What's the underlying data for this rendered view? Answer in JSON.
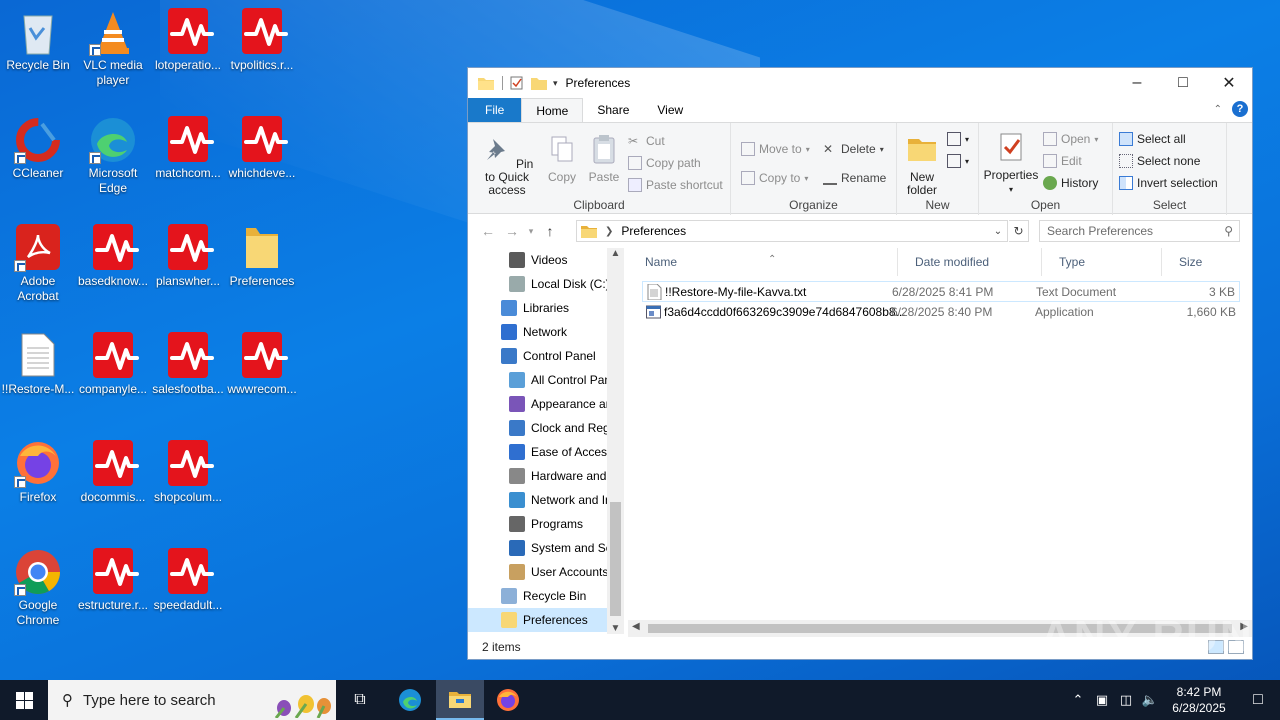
{
  "desktop": {
    "icons": [
      {
        "label": "Recycle Bin",
        "icon": "recycle-bin-icon"
      },
      {
        "label": "VLC media player",
        "icon": "vlc-icon"
      },
      {
        "label": "lotoperatio...",
        "icon": "red-pulse-icon"
      },
      {
        "label": "tvpolitics.r...",
        "icon": "red-pulse-icon"
      },
      {
        "label": "CCleaner",
        "icon": "ccleaner-icon"
      },
      {
        "label": "Microsoft Edge",
        "icon": "edge-icon"
      },
      {
        "label": "matchcom...",
        "icon": "red-pulse-icon"
      },
      {
        "label": "whichdeve...",
        "icon": "red-pulse-icon"
      },
      {
        "label": "Adobe Acrobat",
        "icon": "acrobat-icon"
      },
      {
        "label": "basedknow...",
        "icon": "red-pulse-icon"
      },
      {
        "label": "planswher...",
        "icon": "red-pulse-icon"
      },
      {
        "label": "Preferences",
        "icon": "folder-icon"
      },
      {
        "label": "!!Restore-M...",
        "icon": "text-file-icon"
      },
      {
        "label": "companyle...",
        "icon": "red-pulse-icon"
      },
      {
        "label": "salesfootba...",
        "icon": "red-pulse-icon"
      },
      {
        "label": "wwwrecom...",
        "icon": "red-pulse-icon"
      },
      {
        "label": "Firefox",
        "icon": "firefox-icon"
      },
      {
        "label": "docommis...",
        "icon": "red-pulse-icon"
      },
      {
        "label": "shopcolum...",
        "icon": "red-pulse-icon"
      },
      {
        "label": "Google Chrome",
        "icon": "chrome-icon"
      },
      {
        "label": "estructure.r...",
        "icon": "red-pulse-icon"
      },
      {
        "label": "speedadult...",
        "icon": "red-pulse-icon"
      }
    ]
  },
  "explorer": {
    "title": "Preferences",
    "tabs": {
      "file": "File",
      "home": "Home",
      "share": "Share",
      "view": "View"
    },
    "ribbon": {
      "clipboard": {
        "name": "Clipboard",
        "pin": "Pin to Quick access",
        "copy": "Copy",
        "paste": "Paste",
        "cut": "Cut",
        "copy_path": "Copy path",
        "paste_shortcut": "Paste shortcut"
      },
      "organize": {
        "name": "Organize",
        "move_to": "Move to",
        "copy_to": "Copy to",
        "delete": "Delete",
        "rename": "Rename"
      },
      "new": {
        "name": "New",
        "new_folder": "New folder"
      },
      "open": {
        "name": "Open",
        "properties": "Properties",
        "open": "Open",
        "edit": "Edit",
        "history": "History"
      },
      "select": {
        "name": "Select",
        "select_all": "Select all",
        "select_none": "Select none",
        "invert": "Invert selection"
      }
    },
    "address": "Preferences",
    "search_placeholder": "Search Preferences",
    "nav": [
      {
        "label": "Videos",
        "indent": 2
      },
      {
        "label": "Local Disk (C:)",
        "indent": 2
      },
      {
        "label": "Libraries",
        "indent": 1
      },
      {
        "label": "Network",
        "indent": 1
      },
      {
        "label": "Control Panel",
        "indent": 1
      },
      {
        "label": "All Control Panel Items",
        "indent": 2
      },
      {
        "label": "Appearance and Personalization",
        "indent": 2
      },
      {
        "label": "Clock and Region",
        "indent": 2
      },
      {
        "label": "Ease of Access",
        "indent": 2
      },
      {
        "label": "Hardware and Sound",
        "indent": 2
      },
      {
        "label": "Network and Internet",
        "indent": 2
      },
      {
        "label": "Programs",
        "indent": 2
      },
      {
        "label": "System and Security",
        "indent": 2
      },
      {
        "label": "User Accounts",
        "indent": 2
      },
      {
        "label": "Recycle Bin",
        "indent": 1
      },
      {
        "label": "Preferences",
        "indent": 1
      }
    ],
    "columns": {
      "name": "Name",
      "date": "Date modified",
      "type": "Type",
      "size": "Size"
    },
    "files": [
      {
        "name": "!!Restore-My-file-Kavva.txt",
        "date": "6/28/2025 8:41 PM",
        "type": "Text Document",
        "size": "3 KB"
      },
      {
        "name": "f3a6d4ccdd0f663269c3909e74d6847608b8...",
        "date": "6/28/2025 8:40 PM",
        "type": "Application",
        "size": "1,660 KB"
      }
    ],
    "status": "2 items"
  },
  "watermark": "ANY RUN",
  "taskbar": {
    "search_placeholder": "Type here to search",
    "time": "8:42 PM",
    "date": "6/28/2025"
  },
  "colors": {
    "accent": "#1979ca",
    "pulse_red": "#e4141c",
    "taskbar": "#101a2a"
  }
}
